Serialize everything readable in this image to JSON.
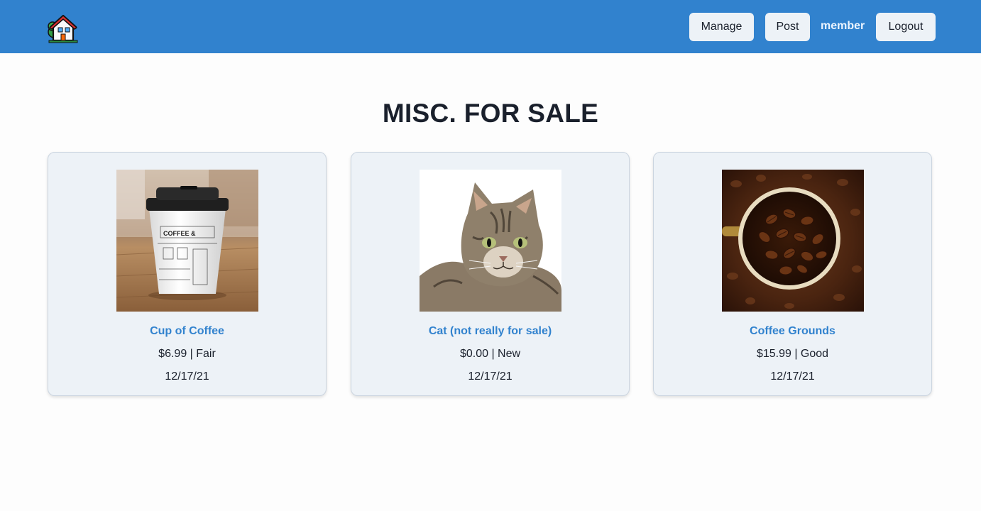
{
  "nav": {
    "logo_icon": "house-icon",
    "manage_label": "Manage",
    "post_label": "Post",
    "user_label": "member",
    "logout_label": "Logout",
    "bar_color": "#3182ce"
  },
  "page": {
    "title": "MISC. FOR SALE"
  },
  "listings": [
    {
      "title": "Cup of Coffee",
      "price": "$6.99",
      "condition": "Fair",
      "meta": "$6.99 | Fair",
      "date": "12/17/21",
      "image": "coffee-cup-photo"
    },
    {
      "title": "Cat (not really for sale)",
      "price": "$0.00",
      "condition": "New",
      "meta": "$0.00 | New",
      "date": "12/17/21",
      "image": "tabby-cat-photo"
    },
    {
      "title": "Coffee Grounds",
      "price": "$15.99",
      "condition": "Good",
      "meta": "$15.99 | Good",
      "date": "12/17/21",
      "image": "coffee-beans-photo"
    }
  ]
}
